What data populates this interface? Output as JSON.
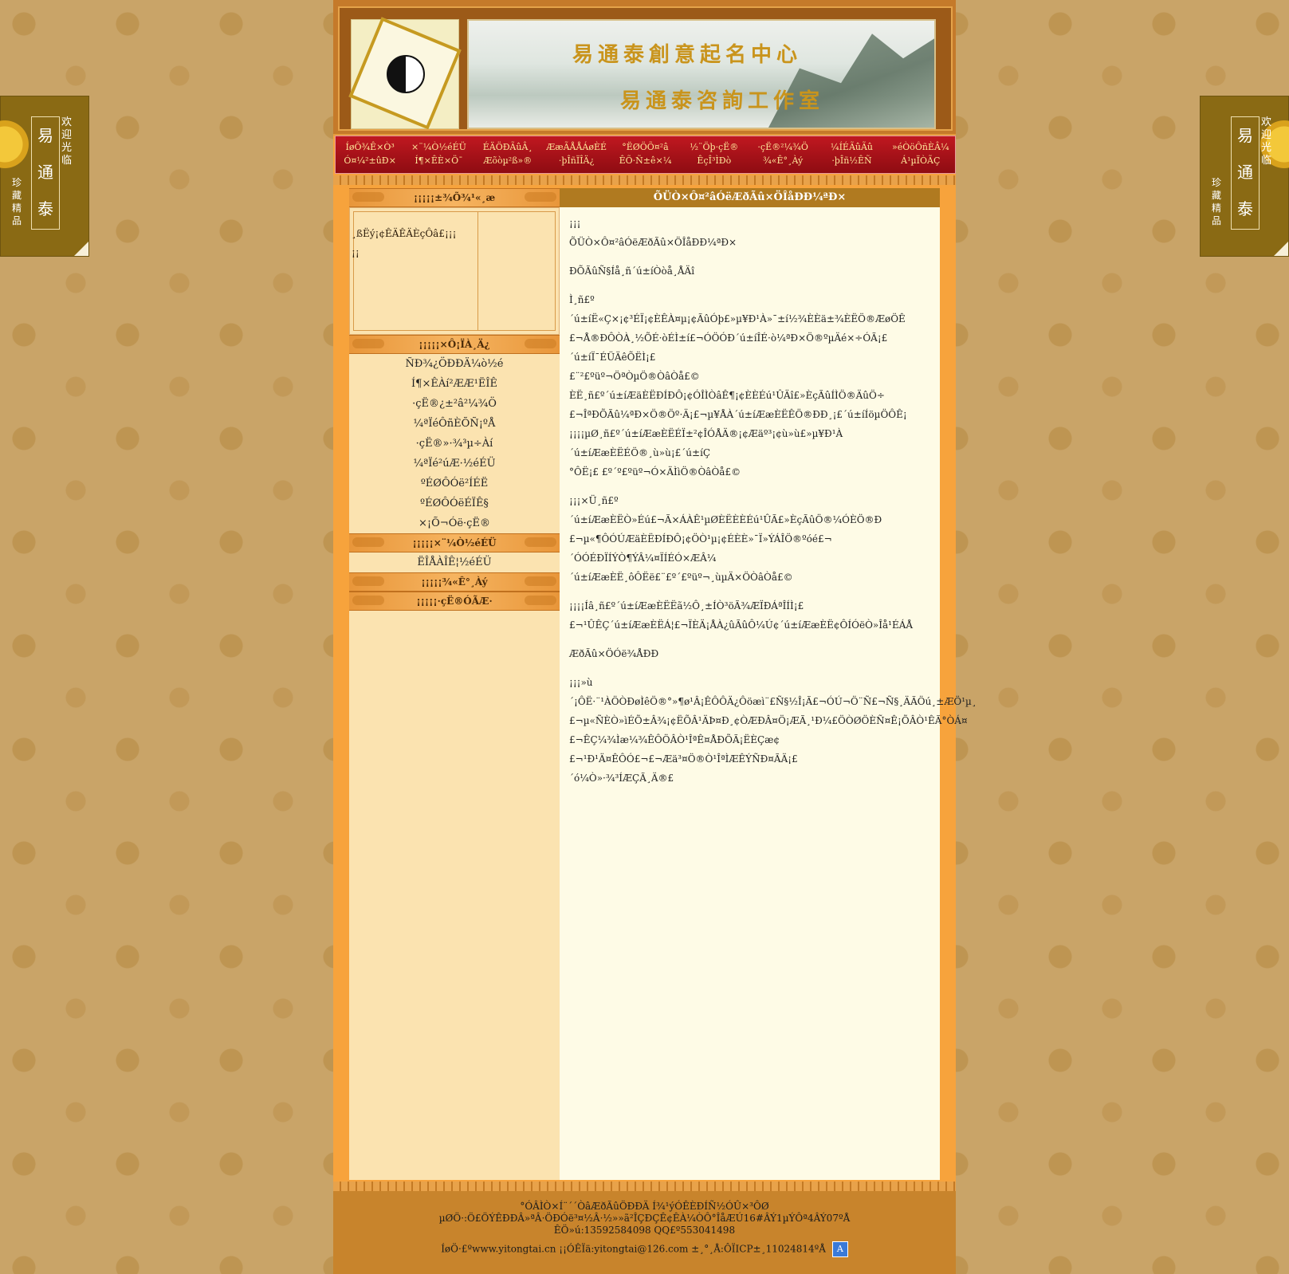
{
  "side_ads": {
    "brand": [
      "易",
      "•",
      "通",
      "•",
      "泰"
    ],
    "welcome": "欢迎光临",
    "treasure": "珍藏精品"
  },
  "header": {
    "banner_line1": "易通泰創意起名中心",
    "banner_line2": "易通泰咨詢工作室"
  },
  "nav": [
    {
      "line1": "ÍøÕ¾Ê×Ò³",
      "line2": "Ó¤¼²±ûÐ×"
    },
    {
      "line1": "×¨¼Ò½éÉÜ",
      "line2": "Í¶×ÊÈ×Ö¯"
    },
    {
      "line1": "ÉÄÖÐÃûÂ¸",
      "line2": "Æõòµ²ß»®"
    },
    {
      "line1": "ÆæÃÅÅÁøÈÉ",
      "line2": "·þÎñÏÎÄ¿"
    },
    {
      "line1": "°ËØÖÕ¤²â",
      "line2": "ÊÕ·Ñ±ê×¼"
    },
    {
      "line1": "½¨Öþ·çË®",
      "line2": "ÊçÎ³ÌÐò"
    },
    {
      "line1": "·çË®²¼¾Ö",
      "line2": "¾«Ê°¸Àý"
    },
    {
      "line1": "¼ÍÉÃûÃû",
      "line2": "·þÎñ½ÊÑ"
    },
    {
      "line1": "»éÒöÔñÈÂ¼",
      "line2": "Á¹µÏÒÃÇ"
    }
  ],
  "left": {
    "head_notice": "¡¡¡¡¡±¾Õ¾¹«¸æ",
    "notice_line1": "¸ßËý¡¢ÊÄÊÄÈçÔâ£¡¡¡",
    "notice_line2": "¡¡",
    "head_services": "¡¡¡¡¡×Ô¡ÏÀ¸Ä¿",
    "services": [
      "ÑÐ¾¿ÖÐÐÄ¼ò½é",
      "Í¶×ÊÀí²ÆÆ¹ËÎÊ",
      "·çË®¿±²â²¼¾Ö",
      "¼ªÏéÔñÈÕÑ¡ºÅ",
      "·çË®»·¾³µ÷Àí",
      "¼ªÏé²úÆ·½éÉÜ",
      "ºÉØÔÓë²ÍÉË",
      "ºÉØÔÓëÉÏÊ§",
      "×¡Õ¬Óë·çË®"
    ],
    "head_experts": "¡¡¡¡¡×¨¼Ò½éÉÜ",
    "experts": [
      "ËÎÅÀÎÊ¦½éÉÜ"
    ],
    "head_cases": "¡¡¡¡¡¾«Ê°¸Àý",
    "head_fengshui": "¡¡¡¡¡·çË®ÓÃÆ·"
  },
  "article": {
    "title": "ÕÜÒ×Ô¤²âÓëÆðÃû×ÖÎåÐÐ¼ªÐ×",
    "paragraphs": [
      "¡¡¡\nÕÜÒ×Ô¤²âÓëÆðÃû×ÖÎåÐÐ¼ªÐ×",
      "ÐÕÃûÑ§Íå¸ñ´ú±íÒòå¸ÅÄî",
      "Ì¸ñ£º´ú±íË«Ç×¡¢³ÉÏ¡¢ÈÊÀ¤µ¡¢ÃûÓþ£»µ¥Ð¹À»¯±í½¾ÈÈä±¾ÈËÖ®ÆøÖÊ\n£¬Å®ÐÔÒÀ¸½ÕÉ·òÉÌ±í£¬ÓÖÓÐ´ú±íÎÉ·ò¼ªÐ×Ö®ºµÄé×÷ÓÃ¡£´ú±íÏ¯ÉÜÄêÕËÌ¡£\n£¨²£ºüº¬ÖªÒµÖ®ÒâÒå£©\nÈË¸ñ£º´ú±íÆäÈËÐÍÐÔ¡¢ÓÎÌÒâÊ¶¡¢ÈÈÉú¹ÛÄî£»ÈçÃûÍÌÖ®ÄûÖ÷\n£¬ÎªÐÕÃû¼ªÐ×Ö®Öº·Ä¡£¬µ¥ÅÀ´ú±íÆæÈËÊÖ®ÐÐ¸¡£´ú±íÍöµÖÔÊ¡\n¡¡¡¡µØ¸ñ£º´ú±íÆæÈËÉÏ±²¢ÎÓÅÄ®¡¢Æäº³¡¢ù»ù£»µ¥Ð¹À´ú±íÆæÈËÉÖ®¸ù»ù¡£´ú±íÇ\n°ÔË¡£ £º´º£ºüº¬Ó×ÄÌìÖ®ÒâÒå£©",
      "¡¡¡×Ü¸ñ£º´ú±íÆæÈËÒ»Éú£¬Ã×ÁÀÊ¹µØÈËÈÈÉú¹ÛÃ£»ÈçÃûÖ®¼ÓÈÖ®Ð\n£¬µ«¶ÔÓÚÆäÈËÐÍÐÔ¡¢ÖÒ¹µ¡¢ÉÈÈ»¯Ï»ÝÁÎÖ®ºóé£¬´ÓÓÉÐÏÍÝÒ¶ÝÂ¼¤ÏÍÉÓ×ÆÂ¼\n´ú±íÆæÈË¸ôÔËë£¨£º´£ºüº¬¸ùµÄ×ÖÒâÒå£©",
      "¡¡¡¡Íâ¸ñ£º´ú±íÆæÈËËã½Ô¸±ÍÒ³öÃ¾ÆÏÐÁªÎÍÌ¡£\n£¬¹ÛÊÇ´ú±íÆæÈËÁ¦£¬ÏÈÄ¡ÅÀ¿ûÃûÔ¼Ú¢´ú±íÆæÈË¢ÔÍÓëÒ»Îå¹ÉÁÅ",
      "ÆðÃû×ÖÓë¾ÅÐÐ",
      "¡¡¡»ù´¡ÔË·¨¹ÀÖÒÐøÌêÖ®°»¶ø¹Â¡ÊÔÔÄ¿Ôöæì¨£Ñ§½Î¡Ã£¬ÓÚ¬Ö¨Ñ£¬Ñ§¸ÄÃÖú¸±ÆÖ¹µ¸\n£¬µ«ÑÈÒ»ìÉÕ±Â¾¡¢ËÕÂ¹ÄÞ¤Ð¸¢ÒÆÐÂ¤Ö¡ÆÃ¸¹Ð¼£ÖÒØÖÈÑ¤Ê¡ÕÂÒ¹ÊÃ°ÒÁ¤\n£¬ÊÇ¼¾Ìæ¼¾ÊÔÖÂÒ¹ÎªÊ¤ÅÐÕÃ¡ËÈÇæ¢£¬¹Ð¹Ä¤ÊÔÓ£¬£¬Æä³¤Ö®Ò¹ÎªÌÆÊÝÑÐ¤ÃÄ¡£\n´ó¼Ò»·¾³ÍÆÇÃ¸Ä®£"
    ]
  },
  "footer": {
    "line1": "°ÓÂÌÒ×Í¨´´ÒâÆðÃûÖÐÐÄ Í¾¹ýÓÊÈÐÍÑ½ÓÛ×³ÔØ",
    "line2": "µØÖ·:Ö£ÖÝÊÐÐÂ»ªÂ·ÖÐÓë³¤½­Â·½»»ã²ÎÇÐÇÊ¢ÊÀ¼ÒÔ°ÎåÆÚ16#ÂÝ1µÝÔª4ÂÝ07ºÅ",
    "line3": "ÊÖ»ú:13592584098      QQ£º553041498",
    "line4": "ÍøÖ·£ºwww.yitongtai.cn ¡¡ÓÊÏä:yitongtai@126.com    ±¸°¸Å:ÔÏICP±¸11024814ºÅ",
    "badge": "A"
  }
}
